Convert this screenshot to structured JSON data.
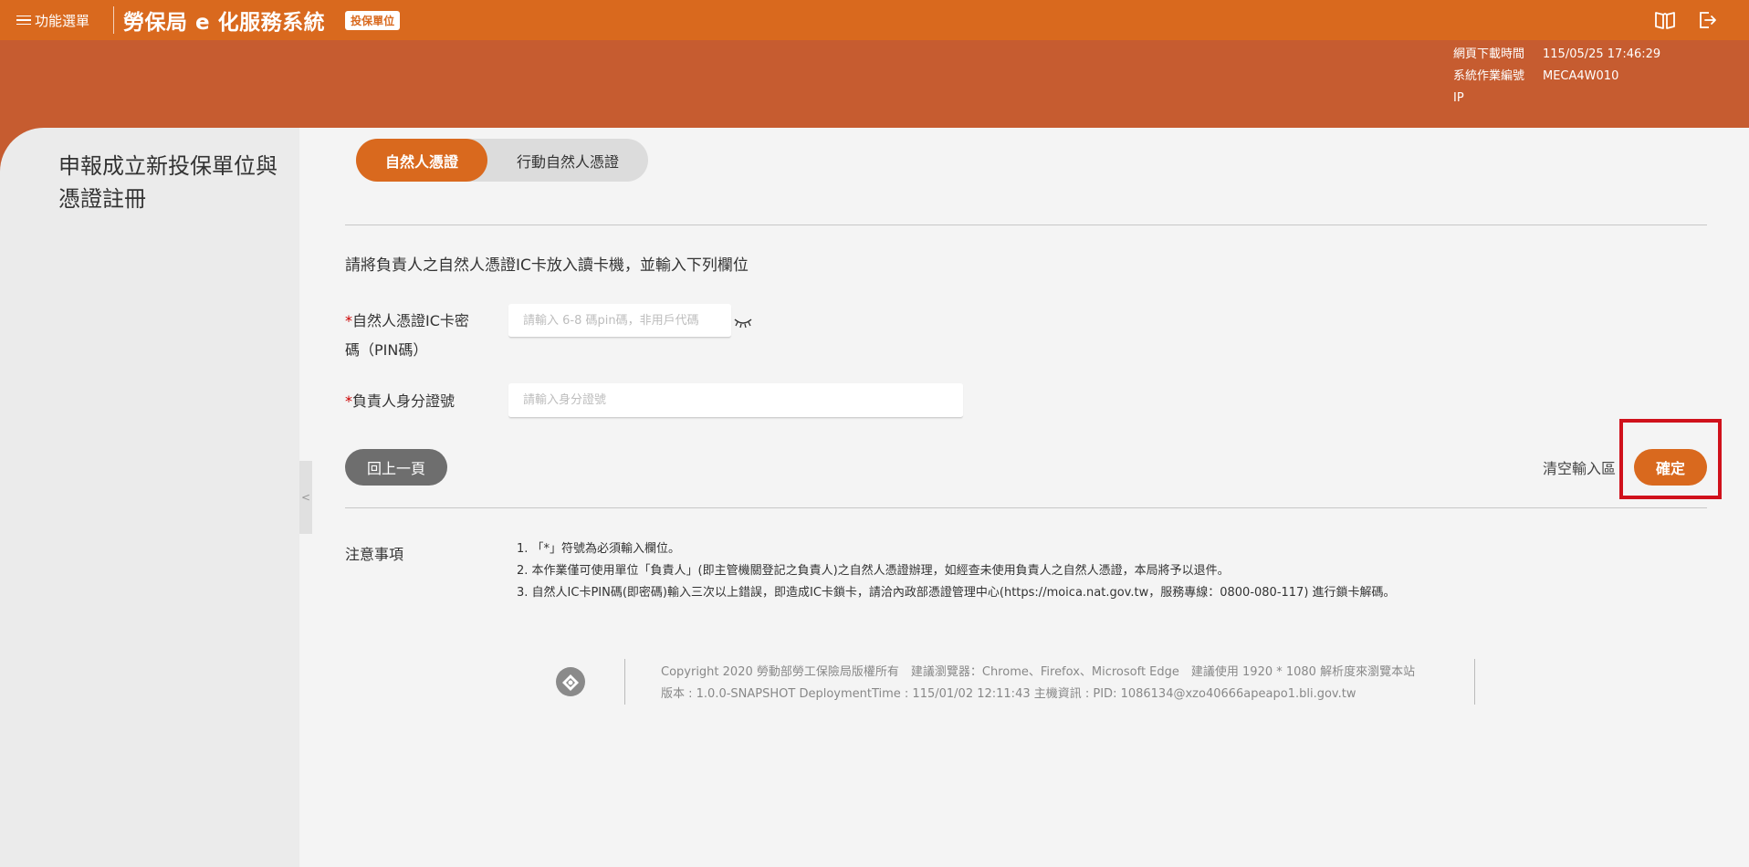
{
  "header": {
    "menu_label": "功能選單",
    "app_title": "勞保局 e 化服務系統",
    "badge": "投保單位",
    "icons": [
      "book-icon",
      "logout-icon"
    ]
  },
  "meta": {
    "download_time_label": "網頁下載時間",
    "download_time_value": "115/05/25 17:46:29",
    "job_id_label": "系統作業編號",
    "job_id_value": "MECA4W010",
    "ip_label": "IP",
    "ip_value": ""
  },
  "sidebar": {
    "page_heading": "申報成立新投保單位與憑證註冊",
    "collapse_glyph": "<"
  },
  "tabs": {
    "active": "自然人憑證",
    "inactive": "行動自然人憑證"
  },
  "form": {
    "instruction": "請將負責人之自然人憑證IC卡放入讀卡機，並輸入下列欄位",
    "required_mark": "*",
    "pin_label": "自然人憑證IC卡密碼（PIN碼）",
    "pin_placeholder": "請輸入 6-8 碼pin碼，非用戶代碼",
    "pin_value": "",
    "id_label": "負責人身分證號",
    "id_placeholder": "請輸入身分證號",
    "id_value": ""
  },
  "actions": {
    "back": "回上一頁",
    "clear": "清空輸入區",
    "confirm": "確定"
  },
  "notes": {
    "label": "注意事項",
    "items": [
      "1. 「*」符號為必須輸入欄位。",
      "2. 本作業僅可使用單位「負責人」(即主管機關登記之負責人)之自然人憑證辦理，如經查未使用負責人之自然人憑證，本局將予以退件。",
      "3. 自然人IC卡PIN碼(即密碼)輸入三次以上錯誤，即造成IC卡鎖卡，請洽內政部憑證管理中心(https://moica.nat.gov.tw，服務專線：0800-080-117) 進行鎖卡解碼。"
    ]
  },
  "footer": {
    "line1": "Copyright 2020 勞動部勞工保險局版權所有　建議瀏覽器：Chrome、Firefox、Microsoft Edge　建議使用 1920 * 1080 解析度來瀏覽本站",
    "line2": "版本 : 1.0.0-SNAPSHOT DeploymentTime : 115/01/02 12:11:43 主機資訊 : PID: 1086134@xzo40666apeapo1.bli.gov.tw"
  },
  "colors": {
    "brand_orange": "#d9691e",
    "band": "#c65c30",
    "highlight": "#d0111b"
  }
}
